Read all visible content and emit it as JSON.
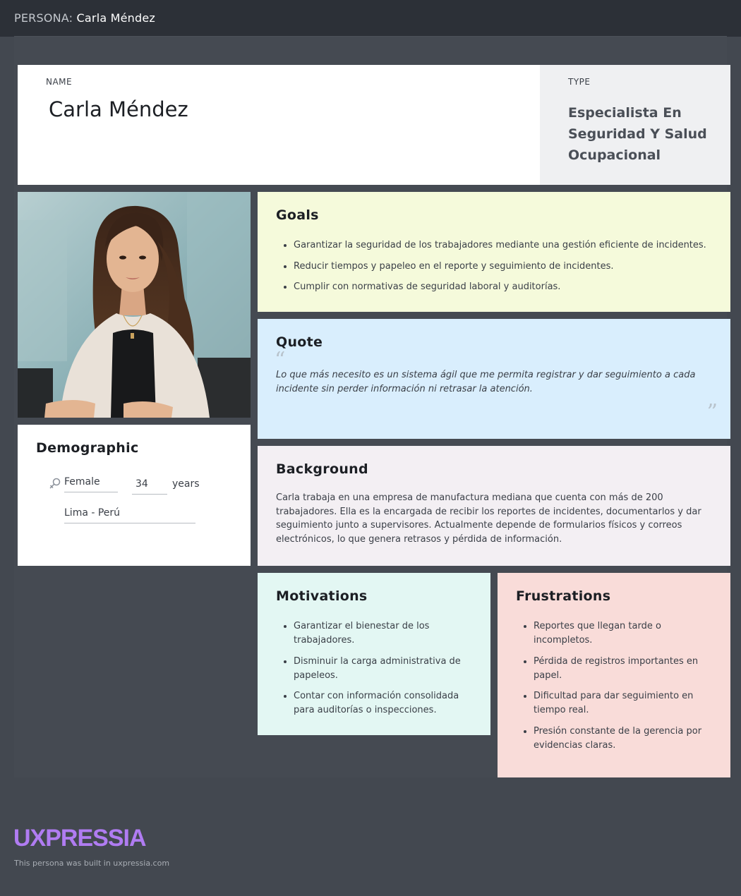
{
  "topbar": {
    "prefix": "PERSONA:",
    "persona_name": "Carla Méndez"
  },
  "persona": {
    "name_label": "NAME",
    "name": "Carla Méndez",
    "type_label": "TYPE",
    "type": "Especialista En Seguridad Y Salud Ocupacional"
  },
  "demographic": {
    "title": "Demographic",
    "gender": "Female",
    "gender_icon": "female-icon",
    "age": "34",
    "age_unit": "years",
    "location": "Lima - Perú"
  },
  "goals": {
    "title": "Goals",
    "items": [
      "Garantizar la seguridad de los trabajadores mediante una gestión eficiente de incidentes.",
      "Reducir tiempos y papeleo en el reporte y seguimiento de incidentes.",
      "Cumplir con normativas de seguridad laboral y auditorías."
    ]
  },
  "quote": {
    "title": "Quote",
    "text": "Lo que más necesito es un sistema ágil que me permita registrar y dar seguimiento a cada incidente sin perder información ni retrasar la atención."
  },
  "background": {
    "title": "Background",
    "text": "Carla trabaja en una empresa de manufactura mediana que cuenta con más de 200 trabajadores. Ella es la encargada de recibir los reportes de incidentes, documentarlos y dar seguimiento junto a supervisores. Actualmente depende de formularios físicos y correos electrónicos, lo que genera retrasos y pérdida de información."
  },
  "motivations": {
    "title": "Motivations",
    "items": [
      "Garantizar el bienestar de los trabajadores.",
      "Disminuir la carga administrativa de papeleos.",
      "Contar con información consolidada para auditorías o inspecciones."
    ]
  },
  "frustrations": {
    "title": "Frustrations",
    "items": [
      "Reportes que llegan tarde o incompletos.",
      "Pérdida de registros importantes en papel.",
      "Dificultad para dar seguimiento en tiempo real.",
      "Presión constante de la gerencia por evidencias claras."
    ]
  },
  "footer": {
    "brand": "UXPRESSIA",
    "note": "This persona was built in uxpressia.com"
  },
  "colors": {
    "page_bg": "#434850",
    "topbar_bg": "#2c3037",
    "goals_bg": "#f5fadb",
    "quote_bg": "#d9eefd",
    "background_bg": "#f3eff3",
    "motivations_bg": "#e3f7f3",
    "frustrations_bg": "#f9dcd9",
    "brand": "#b07cf2"
  }
}
